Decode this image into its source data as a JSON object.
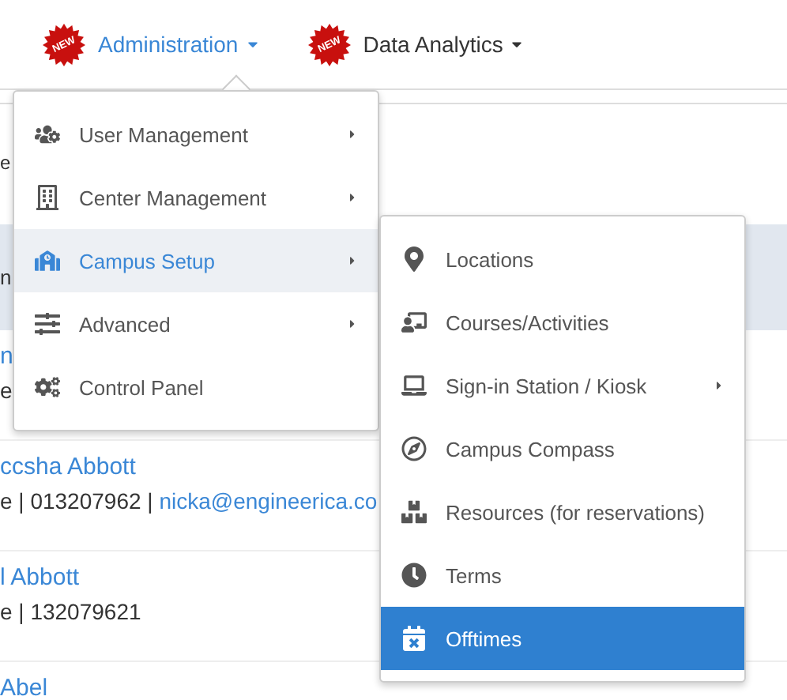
{
  "nav": [
    {
      "label": "Administration",
      "badge": "NEW",
      "selected": true
    },
    {
      "label": "Data Analytics",
      "badge": "NEW",
      "selected": false
    }
  ],
  "menu": {
    "items": [
      {
        "label": "User Management",
        "has_submenu": true,
        "selected": false
      },
      {
        "label": "Center Management",
        "has_submenu": true,
        "selected": false
      },
      {
        "label": "Campus Setup",
        "has_submenu": true,
        "selected": true
      },
      {
        "label": "Advanced",
        "has_submenu": true,
        "selected": false
      },
      {
        "label": "Control Panel",
        "has_submenu": false,
        "selected": false
      }
    ]
  },
  "submenu": {
    "items": [
      {
        "label": "Locations",
        "has_submenu": false,
        "selected": false
      },
      {
        "label": "Courses/Activities",
        "has_submenu": false,
        "selected": false
      },
      {
        "label": "Sign-in Station / Kiosk",
        "has_submenu": true,
        "selected": false
      },
      {
        "label": "Campus Compass",
        "has_submenu": false,
        "selected": false
      },
      {
        "label": "Resources (for reservations)",
        "has_submenu": false,
        "selected": false
      },
      {
        "label": "Terms",
        "has_submenu": false,
        "selected": false
      },
      {
        "label": "Offtimes",
        "has_submenu": false,
        "selected": true
      }
    ]
  },
  "background": {
    "fragment": "e",
    "heading": "n",
    "rows": [
      {
        "name": "n",
        "detail": "e"
      },
      {
        "name": "ccsha Abbott",
        "detail": "e | 013207962 |",
        "email": "nicka@engineerica.co"
      },
      {
        "name": "l Abbott",
        "detail": "e | 132079621"
      },
      {
        "name": "Abel"
      }
    ]
  }
}
